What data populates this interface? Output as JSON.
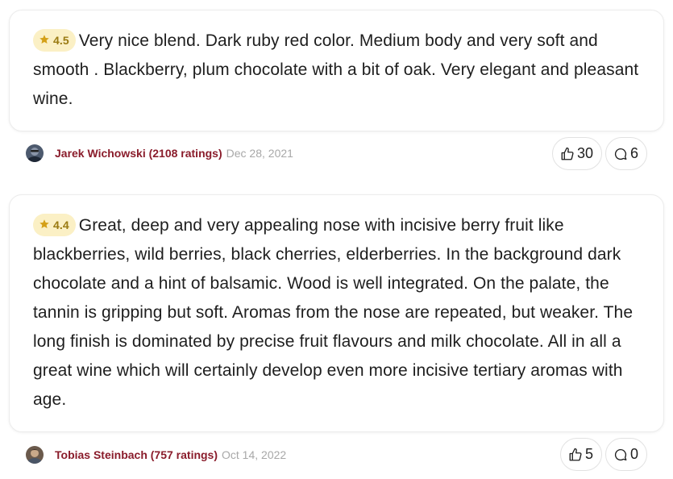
{
  "reviews": [
    {
      "rating": "4.5",
      "text": "Very nice blend. Dark ruby red color. Medium body and very soft and smooth . Blackberry, plum chocolate with a bit of oak. Very elegant and pleasant wine.",
      "author": "Jarek Wichowski (2108 ratings)",
      "date": "Dec 28, 2021",
      "likes": "30",
      "comments": "6"
    },
    {
      "rating": "4.4",
      "text": "Great, deep and very appealing nose with incisive berry fruit like blackberries, wild berries, black cherries, elderberries. In the background dark chocolate and a hint of balsamic. Wood is well integrated. On the palate, the tannin is gripping but soft. Aromas from the nose are repeated, but weaker. The long finish is dominated by precise fruit flavours and milk chocolate. All in all a great wine which will certainly develop even more incisive tertiary aromas with age.",
      "author": "Tobias Steinbach (757 ratings)",
      "date": "Oct 14, 2022",
      "likes": "5",
      "comments": "0"
    }
  ],
  "icons": {
    "rating": "star-icon",
    "like": "thumbs-up-icon",
    "comment": "comment-bubble-icon"
  },
  "colors": {
    "author": "#8a1c2b",
    "badge_bg": "#fbf0c5",
    "badge_text": "#9a7a12",
    "star": "#d4a017",
    "date": "#a8a8a8"
  }
}
